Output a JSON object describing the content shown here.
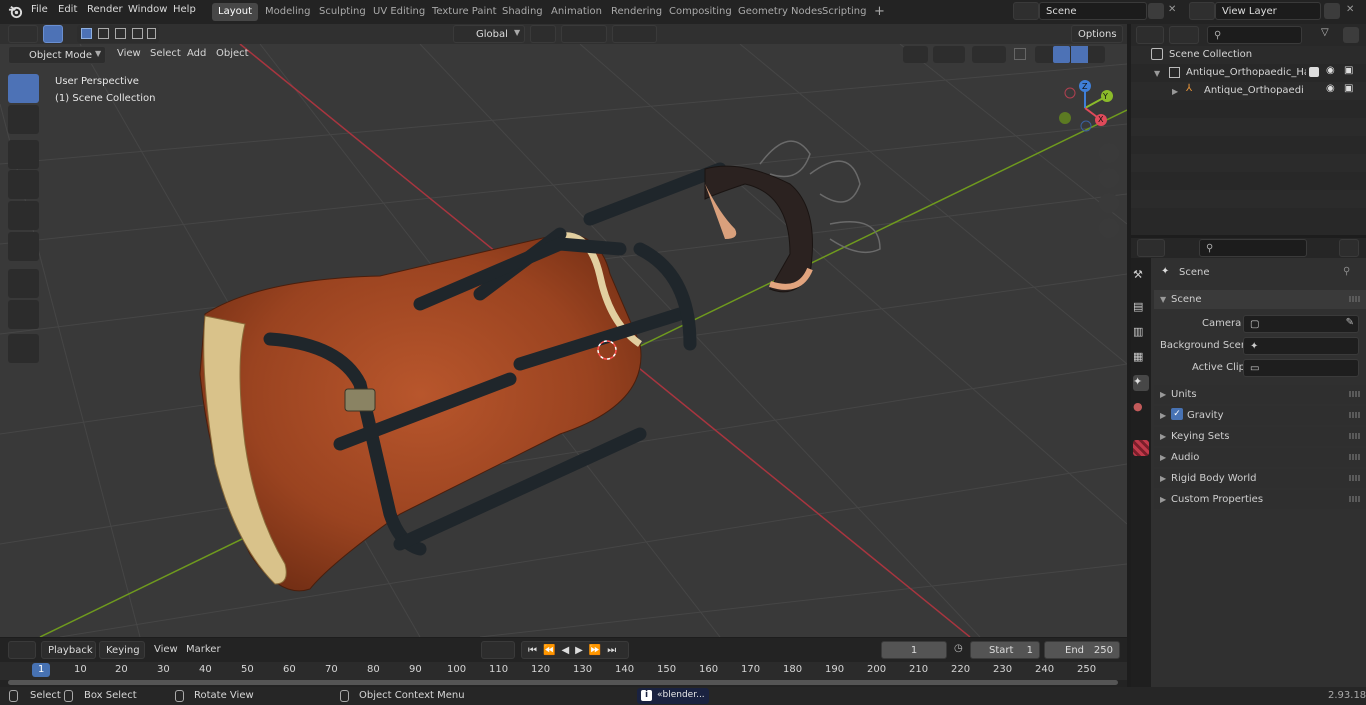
{
  "topbar": {
    "menus": [
      "File",
      "Edit",
      "Render",
      "Window",
      "Help"
    ],
    "workspaces": [
      "Layout",
      "Modeling",
      "Sculpting",
      "UV Editing",
      "Texture Paint",
      "Shading",
      "Animation",
      "Rendering",
      "Compositing",
      "Geometry Nodes",
      "Scripting"
    ],
    "active_workspace": "Layout",
    "scene_name": "Scene",
    "view_layer": "View Layer"
  },
  "viewport_header": {
    "mode": "Object Mode",
    "menus": [
      "View",
      "Select",
      "Add",
      "Object"
    ],
    "orientation": "Global",
    "options_label": "Options"
  },
  "viewport": {
    "perspective_label": "User Perspective",
    "collection_label": "(1) Scene Collection",
    "gizmo_axes": [
      "X",
      "Y",
      "Z"
    ]
  },
  "outliner": {
    "root": "Scene Collection",
    "items": [
      {
        "label": "Antique_Orthopaedic_Hand_S"
      },
      {
        "label": "Antique_Orthopaedic_Ha"
      }
    ]
  },
  "properties": {
    "context": "Scene",
    "panel_title": "Scene",
    "fields": [
      {
        "label": "Camera",
        "value": ""
      },
      {
        "label": "Background Scene",
        "value": ""
      },
      {
        "label": "Active Clip",
        "value": ""
      }
    ],
    "sections": [
      "Units",
      "Gravity",
      "Keying Sets",
      "Audio",
      "Rigid Body World",
      "Custom Properties"
    ],
    "gravity_checked": true
  },
  "timeline": {
    "menus": [
      "Playback",
      "Keying",
      "View",
      "Marker"
    ],
    "current_frame": "1",
    "start_label": "Start",
    "start_value": "1",
    "end_label": "End",
    "end_value": "250",
    "ruler": [
      "1",
      "10",
      "20",
      "30",
      "40",
      "50",
      "60",
      "70",
      "80",
      "90",
      "100",
      "110",
      "120",
      "130",
      "140",
      "150",
      "160",
      "170",
      "180",
      "190",
      "200",
      "210",
      "220",
      "230",
      "240",
      "250"
    ]
  },
  "statusbar": {
    "select": "Select",
    "box_select": "Box Select",
    "rotate_view": "Rotate View",
    "context_menu": "Object Context Menu",
    "notification": "«blender...",
    "version": "2.93.18"
  },
  "colors": {
    "accent": "#4772b3",
    "x_axis": "#e04a5a",
    "y_axis": "#8bbb2a",
    "z_axis": "#3f7fd8"
  }
}
